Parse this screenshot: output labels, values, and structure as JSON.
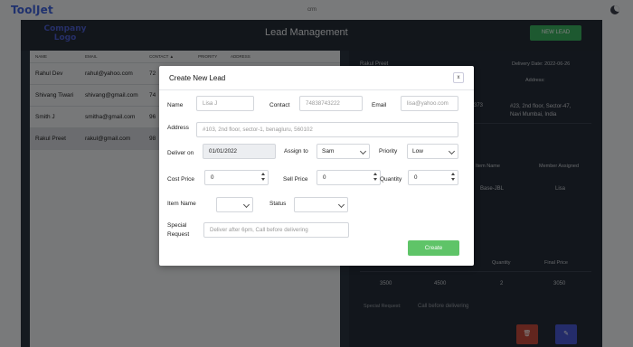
{
  "app": {
    "brand": "ToolJet",
    "app_name": "crm",
    "logo_text": "Company Logo",
    "page_title": "Lead Management",
    "new_lead_label": "NEW LEAD"
  },
  "table": {
    "columns": [
      "NAME",
      "EMAIL",
      "CONTACT ▲",
      "PRIORITY",
      "ADDRESS"
    ],
    "rows": [
      {
        "name": "Rahul Dev",
        "email": "rahul@yahoo.com",
        "contact": "72"
      },
      {
        "name": "Shivang Tiwari",
        "email": "shivang@gmail.com",
        "contact": "74"
      },
      {
        "name": "Smith J",
        "email": "smitha@gmail.com",
        "contact": "96"
      },
      {
        "name": "Rakul Preet",
        "email": "rakul@gmail.com",
        "contact": "98"
      }
    ]
  },
  "detail": {
    "name": "Rakul Preet",
    "delivery_date": "Delivery Date: 2022-06-26",
    "address_label": "Address:",
    "email_fragment": "373",
    "address": "#23, 2nd floor, Sector-47, Navi Mumbai, India",
    "item_name_header": "Item Name",
    "member_assigned_header": "Member Assigned",
    "item_name": "Base-JBL",
    "member_assigned": "Lisa",
    "quantity_header": "Quantity",
    "final_price_header": "Final Price",
    "cost_price": "3500",
    "sell_price": "4500",
    "quantity": "2",
    "final_price": "3050",
    "special_request_label": "Special Request:",
    "special_request": "Call before delivering"
  },
  "modal": {
    "title": "Create New Lead",
    "close_label": "x",
    "name_label": "Name",
    "name_placeholder": "Lisa J",
    "contact_label": "Contact",
    "contact_placeholder": "74838743222",
    "email_label": "Email",
    "email_placeholder": "lisa@yahoo.com",
    "address_label": "Address",
    "address_placeholder": "#103, 2nd floor, sector-1, benagluru, 560102",
    "deliver_on_label": "Deliver on",
    "deliver_on_value": "01/01/2022",
    "assign_to_label": "Assign to",
    "assign_to_value": "Sam",
    "priority_label": "Priority",
    "priority_value": "Low",
    "cost_price_label": "Cost Price",
    "cost_price_value": "0",
    "sell_price_label": "Sell Price",
    "sell_price_value": "0",
    "quantity_label": "Quantity",
    "quantity_value": "0",
    "item_name_label": "Item Name",
    "item_name_value": "",
    "status_label": "Status",
    "status_value": "",
    "special_request_label": "Special Request",
    "special_request_placeholder": "Deliver after 6pm, Call before delivering",
    "create_label": "Create"
  },
  "colors": {
    "brand": "#3e63dd",
    "accent_green": "#3bb260",
    "create_green": "#5fc468",
    "danger": "#c54b3c",
    "edit_blue": "#4958d4"
  },
  "icons": {
    "theme_toggle": "moon-icon",
    "delete": "trash-icon",
    "edit": "pencil-icon"
  }
}
